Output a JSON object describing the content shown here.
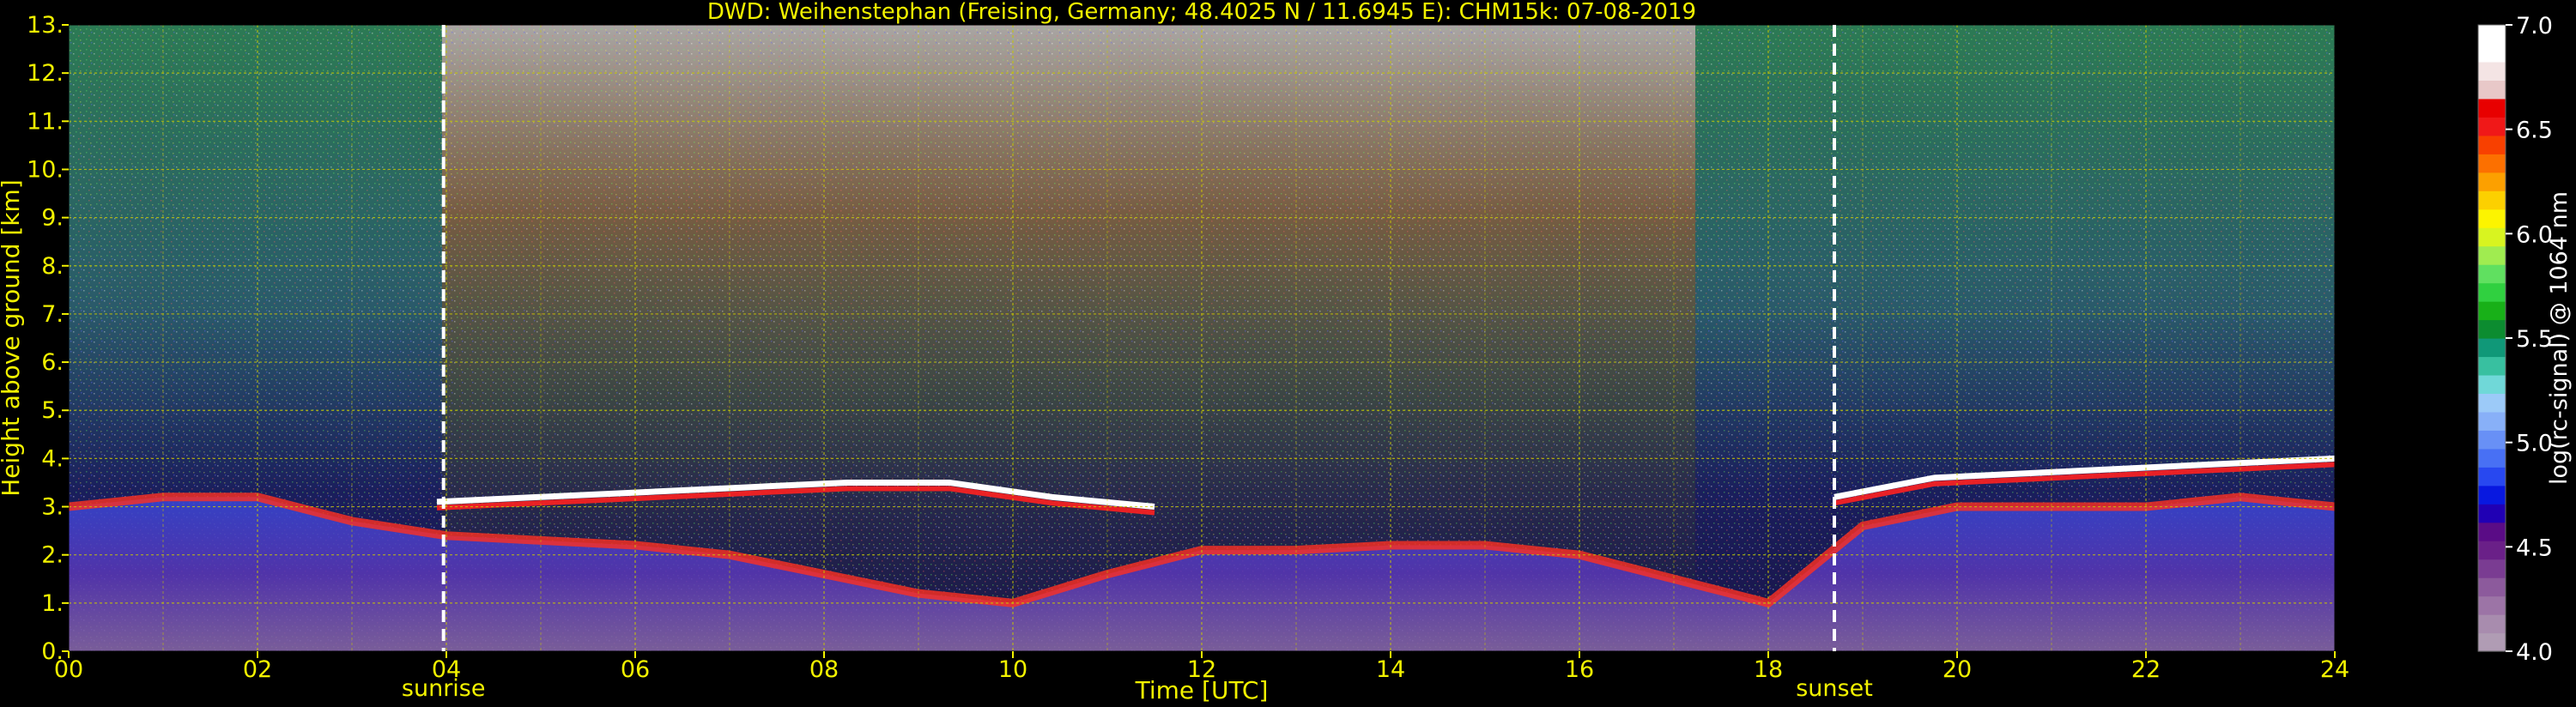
{
  "chart_data": {
    "type": "heatmap",
    "title": "DWD: Weihenstephan (Freising, Germany; 48.4025 N / 11.6945 E):    CHM15k: 07-08-2019",
    "xlabel": "Time [UTC]",
    "ylabel": "Height above ground [km]",
    "xlim": [
      0,
      24
    ],
    "ylim": [
      0,
      13
    ],
    "x_ticks": [
      "00",
      "02",
      "04",
      "06",
      "08",
      "10",
      "12",
      "14",
      "16",
      "18",
      "20",
      "22",
      "24"
    ],
    "y_ticks": [
      "0.",
      "1.",
      "2.",
      "3.",
      "4.",
      "5.",
      "6.",
      "7.",
      "8.",
      "9.",
      "10.",
      "11.",
      "12.",
      "13."
    ],
    "grid": true,
    "annotations": [
      {
        "label": "sunrise",
        "time": 3.97
      },
      {
        "label": "sunset",
        "time": 18.7
      }
    ],
    "colorbar": {
      "label": "log(rc-signal) @ 1064 nm",
      "range": [
        4.0,
        7.0
      ],
      "ticks": [
        "4.0",
        "4.5",
        "5.0",
        "5.5",
        "6.0",
        "6.5",
        "7.0"
      ],
      "colors": [
        "#b09cb4",
        "#a88cae",
        "#9c74a6",
        "#8c5a9c",
        "#7a3c92",
        "#6a2088",
        "#5a0c86",
        "#2000b4",
        "#0818e0",
        "#2848f0",
        "#4870f4",
        "#6890f6",
        "#88b0f8",
        "#9ccaf8",
        "#70d8d8",
        "#38c0a0",
        "#109878",
        "#0c8c30",
        "#18b018",
        "#30d040",
        "#60e060",
        "#a0ec50",
        "#d8f420",
        "#fcf400",
        "#fcd000",
        "#fca000",
        "#fc7000",
        "#f84000",
        "#f01818",
        "#e80000",
        "#e8c8c8",
        "#f4e4e4",
        "#ffffff",
        "#ffffff"
      ]
    },
    "layers": [
      {
        "name": "boundary-layer-aerosol",
        "t_start": 0,
        "t_end": 24,
        "heights_km": [
          3.0,
          3.2,
          3.2,
          2.7,
          2.4,
          2.3,
          2.2,
          2.0,
          1.6,
          1.2,
          1.0,
          1.6,
          2.1,
          2.1,
          2.2,
          2.2,
          2.0,
          1.5,
          1.0,
          2.6,
          3.0,
          3.0,
          3.0,
          3.2,
          3.0
        ]
      },
      {
        "name": "cloud-layer-morning",
        "t_start": 3.9,
        "t_end": 11.5,
        "heights_km": [
          3.1,
          3.2,
          3.3,
          3.4,
          3.5,
          3.5,
          3.2,
          3.0
        ]
      },
      {
        "name": "cloud-layer-evening",
        "t_start": 18.7,
        "t_end": 24,
        "heights_km": [
          3.2,
          3.6,
          3.7,
          3.8,
          3.9,
          4.0
        ]
      }
    ]
  }
}
